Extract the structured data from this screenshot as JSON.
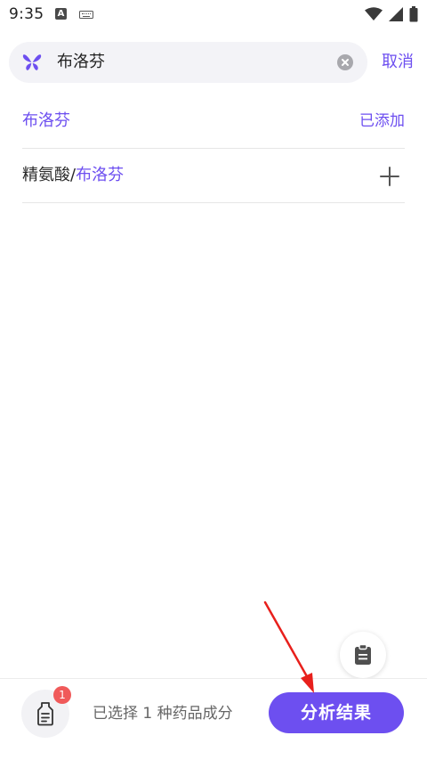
{
  "status_bar": {
    "time": "9:35",
    "icons": [
      "a-notification-icon",
      "keyboard-icon",
      "wifi-icon",
      "signal-icon",
      "battery-icon"
    ]
  },
  "search": {
    "query": "布洛芬",
    "cancel_label": "取消"
  },
  "results": [
    {
      "name_prefix": "",
      "name_match": "布洛芬",
      "status": "已添加"
    },
    {
      "name_prefix": "精氨酸/",
      "name_match": "布洛芬",
      "status": ""
    }
  ],
  "bottom_bar": {
    "badge_count": "1",
    "selected_text": "已选择 1 种药品成分",
    "analyze_label": "分析结果"
  },
  "colors": {
    "accent": "#6d4ff0",
    "badge": "#f05a5a",
    "annotation": "#e8201c"
  }
}
